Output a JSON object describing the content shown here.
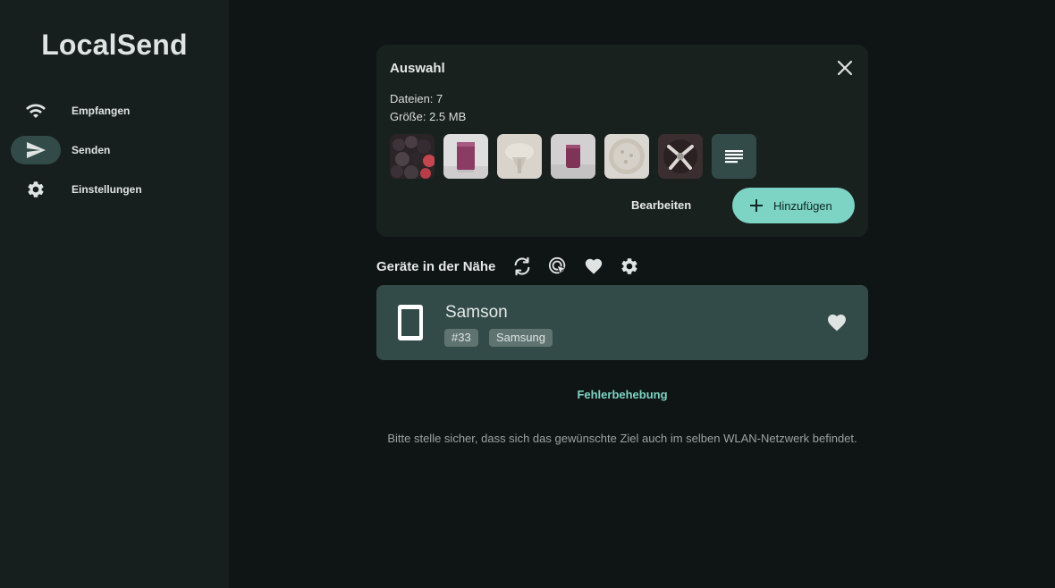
{
  "app": {
    "title": "LocalSend"
  },
  "sidebar": {
    "items": [
      {
        "label": "Empfangen",
        "icon": "wifi-icon"
      },
      {
        "label": "Senden",
        "icon": "send-icon"
      },
      {
        "label": "Einstellungen",
        "icon": "gear-icon"
      }
    ],
    "active_index": 1
  },
  "selection": {
    "title": "Auswahl",
    "files_line": "Dateien: 7",
    "size_line": "Größe: 2.5 MB",
    "edit_label": "Bearbeiten",
    "add_label": "Hinzufügen"
  },
  "nearby": {
    "title": "Geräte in der Nähe"
  },
  "device": {
    "name": "Samson",
    "tags": [
      "#33",
      "Samsung"
    ]
  },
  "troubleshoot_label": "Fehlerbehebung",
  "hint": "Bitte stelle sicher, dass sich das gewünschte Ziel auch im selben WLAN-Netzwerk befindet.",
  "colors": {
    "accent": "#7dd3c4",
    "sidebar_bg": "#161f1e",
    "main_bg": "#0f1514",
    "card_bg": "#19211f",
    "device_bg": "#334b48"
  }
}
